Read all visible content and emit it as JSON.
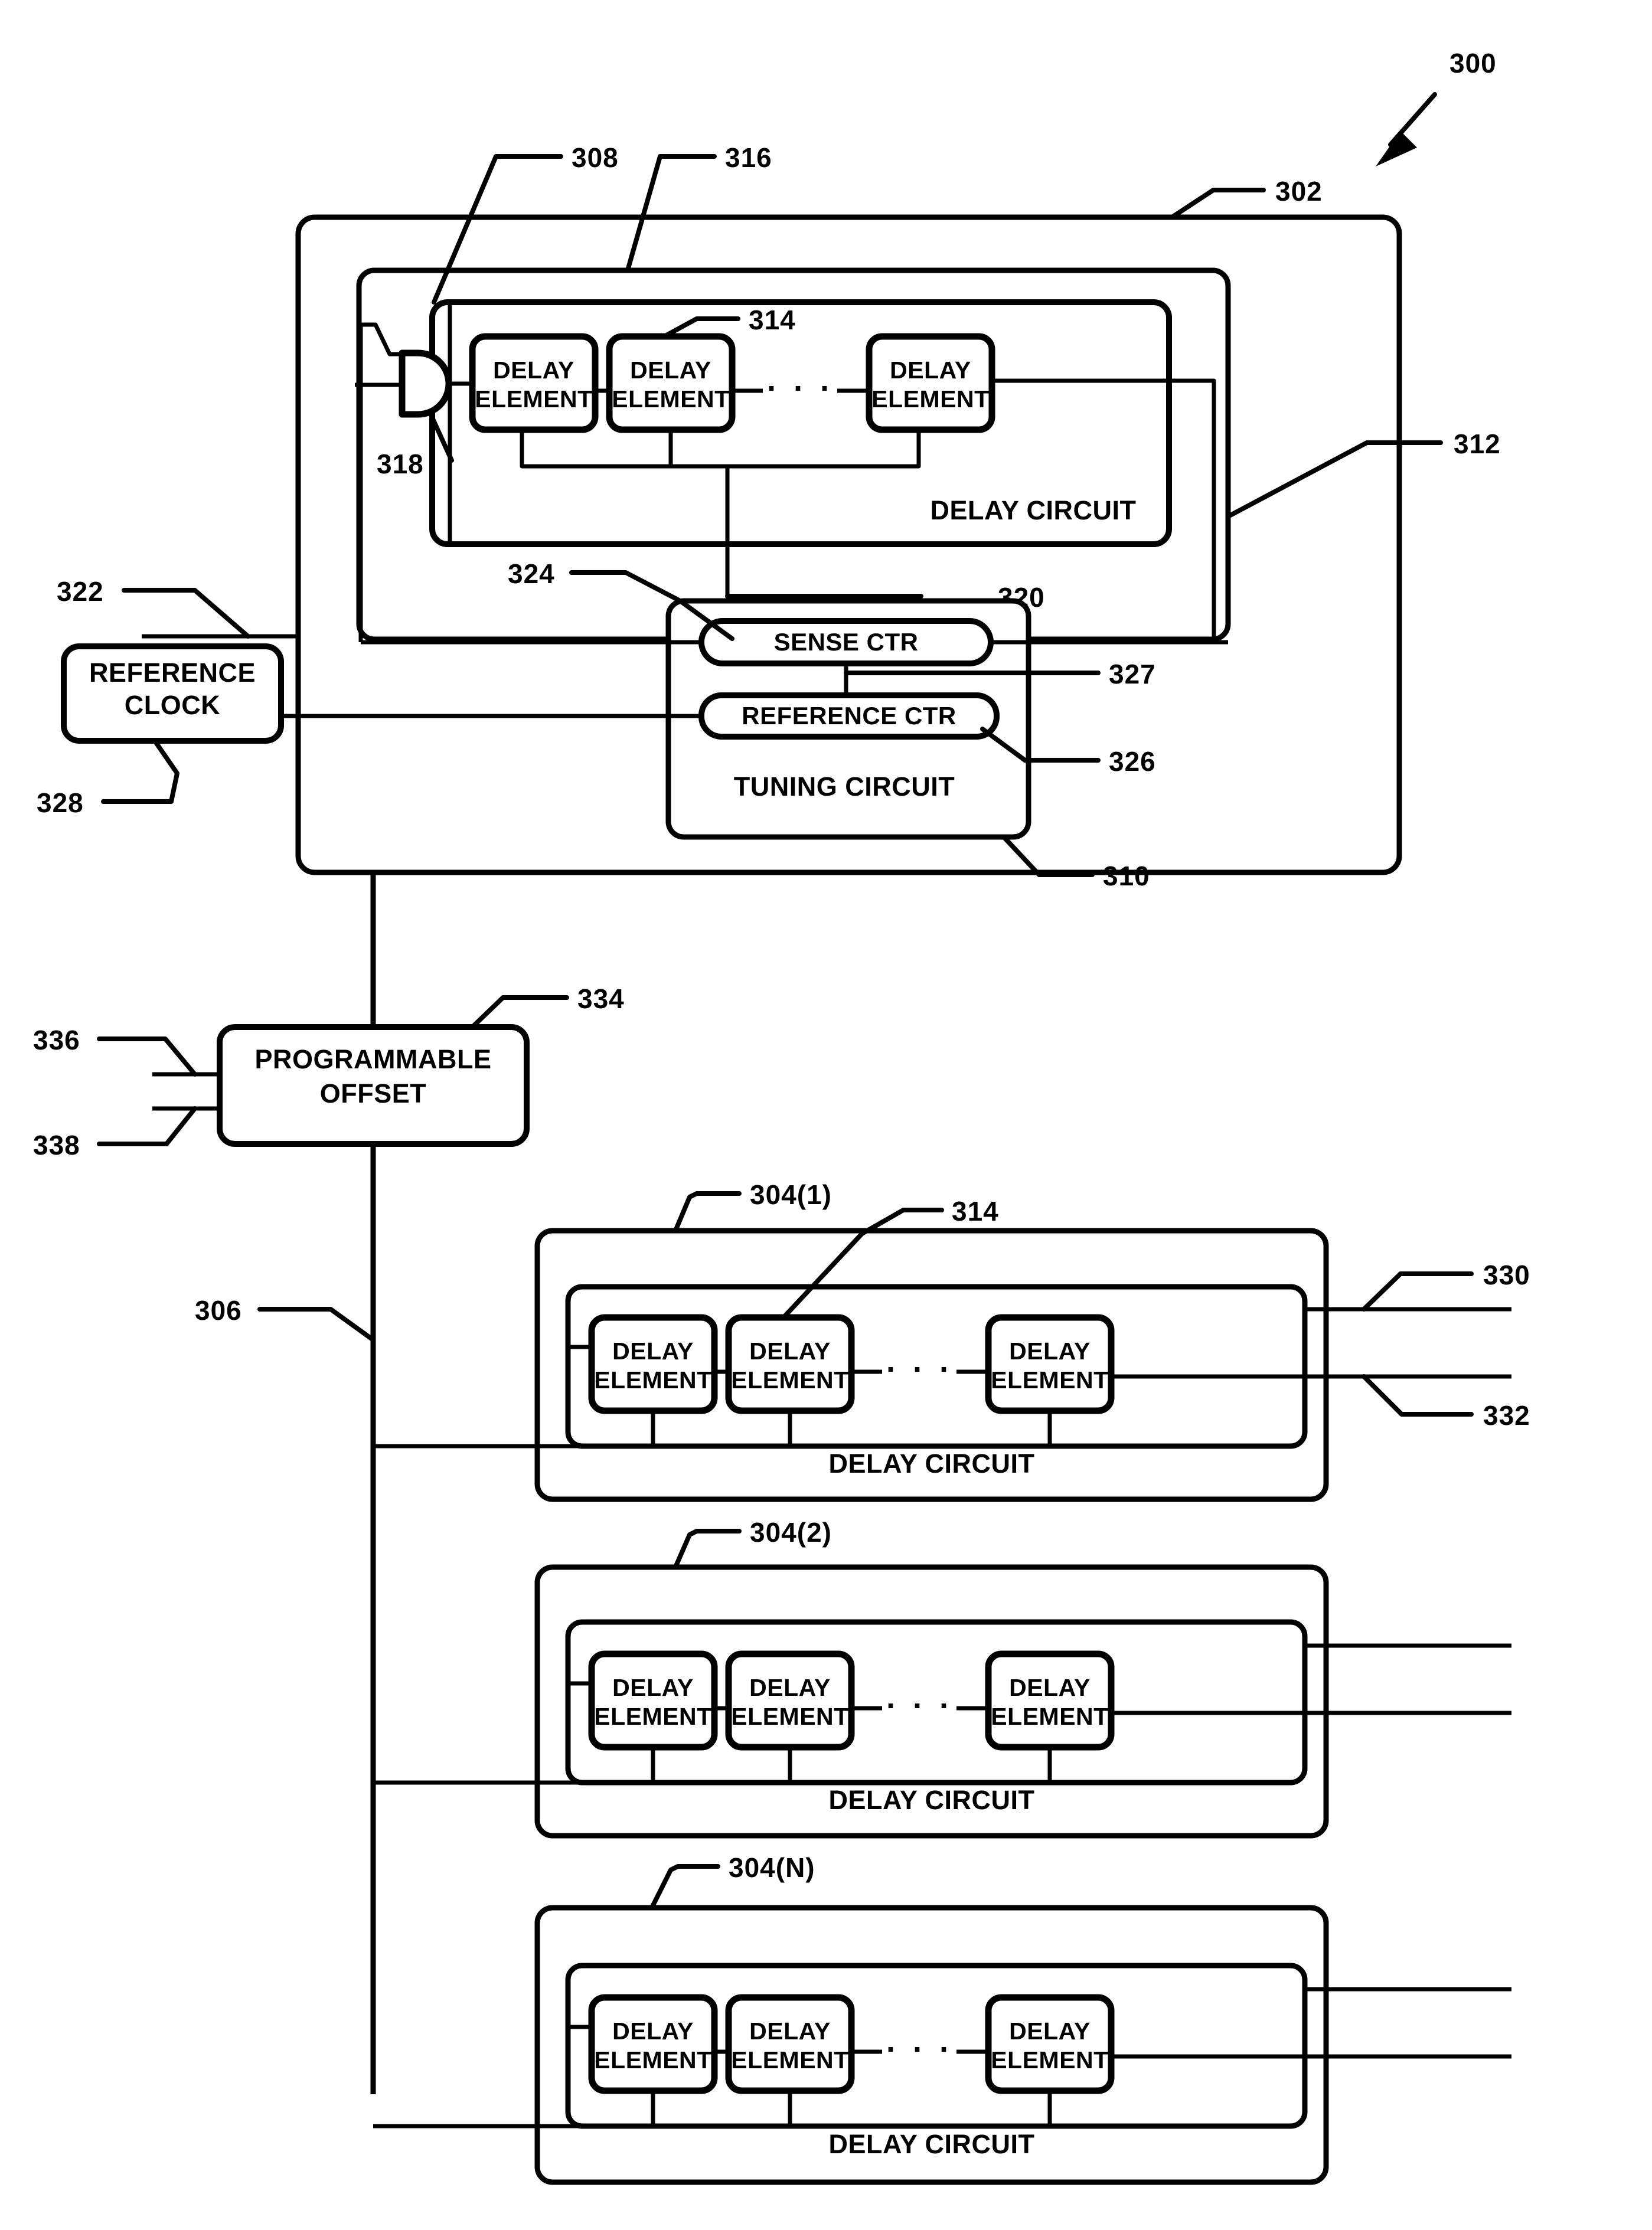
{
  "figure": {
    "title_ref": "300",
    "type": "patent-block-diagram",
    "labels": {
      "ref_300": "300",
      "ref_302": "302",
      "ref_304_1": "304(1)",
      "ref_304_2": "304(2)",
      "ref_304_N": "304(N)",
      "ref_306": "306",
      "ref_308": "308",
      "ref_310": "310",
      "ref_312": "312",
      "ref_314_top": "314",
      "ref_314_bottom": "314",
      "ref_316": "316",
      "ref_318": "318",
      "ref_320": "320",
      "ref_322": "322",
      "ref_324": "324",
      "ref_326": "326",
      "ref_327": "327",
      "ref_328": "328",
      "ref_330": "330",
      "ref_332": "332",
      "ref_334": "334",
      "ref_336": "336",
      "ref_338": "338"
    },
    "blocks": {
      "reference_clock": "REFERENCE\nCLOCK",
      "reference_clock_line1": "REFERENCE",
      "reference_clock_line2": "CLOCK",
      "programmable_offset_line1": "PROGRAMMABLE",
      "programmable_offset_line2": "OFFSET",
      "delay_circuit": "DELAY CIRCUIT",
      "tuning_circuit": "TUNING CIRCUIT",
      "sense_ctr": "SENSE CTR",
      "reference_ctr": "REFERENCE CTR",
      "delay_element_line1": "DELAY",
      "delay_element_line2": "ELEMENT",
      "ellipsis": "· · ·"
    },
    "colors": {
      "ink": "#000000",
      "paper": "#ffffff"
    }
  }
}
